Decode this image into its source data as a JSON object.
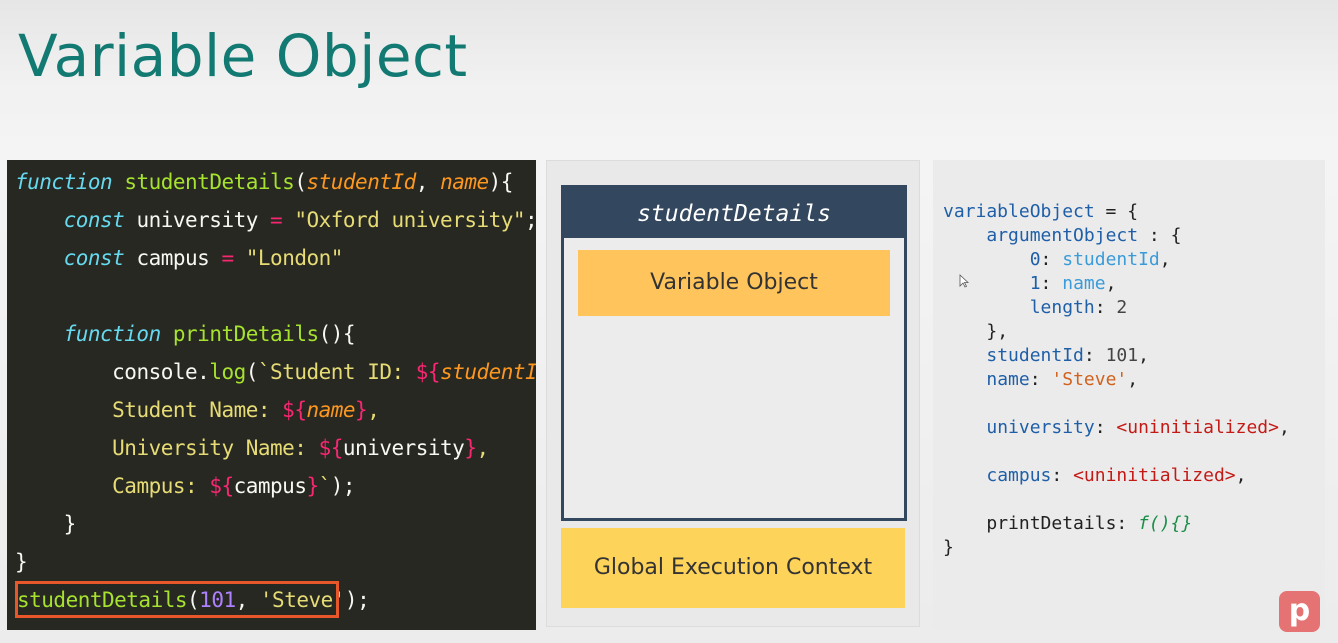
{
  "slide": {
    "title": "Variable Object"
  },
  "code": {
    "l1": {
      "kw": "function",
      "sp": " ",
      "fn": "studentDetails",
      "open": "(",
      "p1": "studentId",
      "comma": ", ",
      "p2": "name",
      "close": "){"
    },
    "l2": {
      "indent": "    ",
      "kw": "const",
      "rest": " university ",
      "op": "=",
      "sp": " ",
      "str": "\"Oxford university\"",
      "semi": ";"
    },
    "l3": {
      "indent": "    ",
      "kw": "const",
      "rest": " campus ",
      "op": "=",
      "sp": " ",
      "str": "\"London\""
    },
    "l5": {
      "indent": "    ",
      "kw": "function",
      "sp": " ",
      "fn": "printDetails",
      "rest": "(){"
    },
    "l6": {
      "indent": "        ",
      "obj": "console.",
      "fn": "log",
      "open": "(",
      "str": "`Student ID: ",
      "tpl": "${",
      "param": "studentId",
      "tplc": "}",
      "comma": ","
    },
    "l7": {
      "indent": "        ",
      "str": "Student Name: ",
      "tpl": "${",
      "param": "name",
      "tplc": "}",
      "comma": ","
    },
    "l8": {
      "indent": "        ",
      "str": "University Name: ",
      "tpl": "${",
      "var": "university",
      "tplc": "}",
      "comma": ","
    },
    "l9": {
      "indent": "        ",
      "str": "Campus: ",
      "tpl": "${",
      "var": "campus",
      "tplc": "}",
      "tick": "`",
      "end": ");"
    },
    "l10": {
      "indent": "    ",
      "text": "}"
    },
    "l11": {
      "text": "}"
    },
    "l12": {
      "fn": "studentDetails",
      "open": "(",
      "num": "101",
      "comma": ", ",
      "str": "'Steve'",
      "end": ");"
    }
  },
  "stack": {
    "context_name": "studentDetails",
    "variable_object_label": "Variable Object",
    "global_label": "Global Execution Context"
  },
  "variable_object": {
    "l1": {
      "key": "variableObject",
      "rest": " = {"
    },
    "l2": {
      "indent": "    ",
      "key": "argumentObject",
      "rest": " : {"
    },
    "l3": {
      "indent": "        ",
      "key": "0",
      "colon": ": ",
      "val": "studentId",
      "comma": ","
    },
    "l4": {
      "indent": "        ",
      "key": "1",
      "colon": ": ",
      "val": "name",
      "comma": ","
    },
    "l5": {
      "indent": "        ",
      "key": "length",
      "colon": ": ",
      "val": "2"
    },
    "l6": {
      "indent": "    ",
      "text": "},"
    },
    "l7": {
      "indent": "    ",
      "key": "studentId",
      "colon": ": ",
      "val": "101",
      "comma": ","
    },
    "l8": {
      "indent": "    ",
      "key": "name",
      "colon": ": ",
      "val": "'Steve'",
      "comma": ","
    },
    "l10": {
      "indent": "    ",
      "key": "university",
      "colon": ": ",
      "val": "<uninitialized>",
      "comma": ","
    },
    "l12": {
      "indent": "    ",
      "key": "campus",
      "colon": ": ",
      "val": "<uninitialized>",
      "comma": ","
    },
    "l14": {
      "indent": "    ",
      "key": "printDetails",
      "colon": ": ",
      "val": "f(){}"
    },
    "l15": {
      "text": "}"
    }
  },
  "brand": {
    "logo_letter": "p"
  },
  "colors": {
    "title": "#127a72",
    "stack_header": "#33475f",
    "vo_box": "#ffc55c",
    "gec_box": "#fdd35a",
    "highlight": "#e8572a"
  }
}
